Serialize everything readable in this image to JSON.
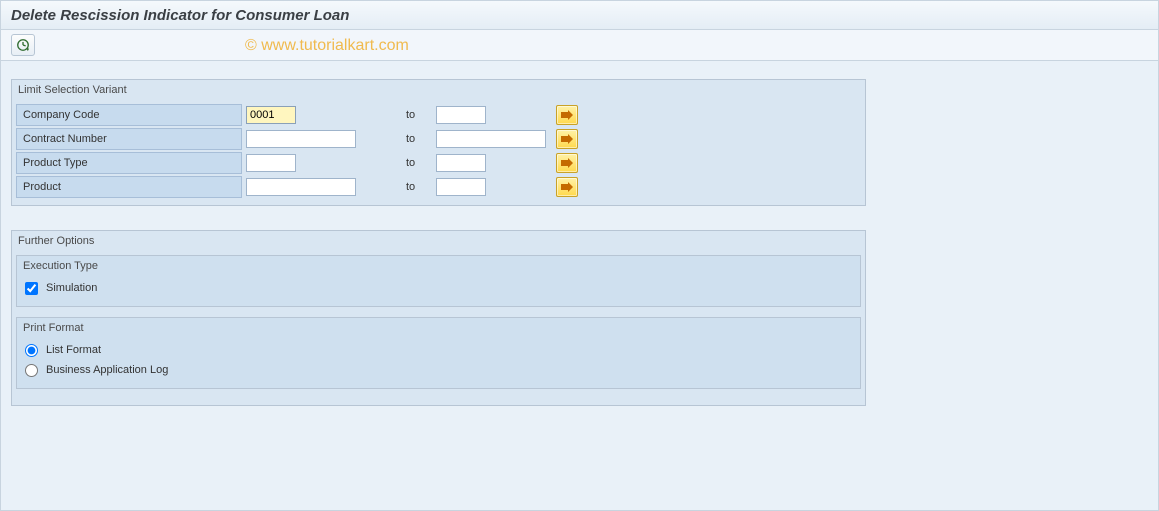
{
  "title": "Delete Rescission Indicator for Consumer Loan",
  "watermark": "© www.tutorialkart.com",
  "groups": {
    "selection": {
      "title": "Limit Selection Variant",
      "to_label": "to",
      "rows": {
        "company_code": {
          "label": "Company Code",
          "from": "0001",
          "to": ""
        },
        "contract_number": {
          "label": "Contract Number",
          "from": "",
          "to": ""
        },
        "product_type": {
          "label": "Product Type",
          "from": "",
          "to": ""
        },
        "product": {
          "label": "Product",
          "from": "",
          "to": ""
        }
      }
    },
    "further": {
      "title": "Further Options",
      "execution": {
        "title": "Execution Type",
        "simulation_label": "Simulation",
        "simulation_checked": true
      },
      "print": {
        "title": "Print Format",
        "list_label": "List Format",
        "bal_label": "Business Application Log",
        "selected": "list"
      }
    }
  }
}
